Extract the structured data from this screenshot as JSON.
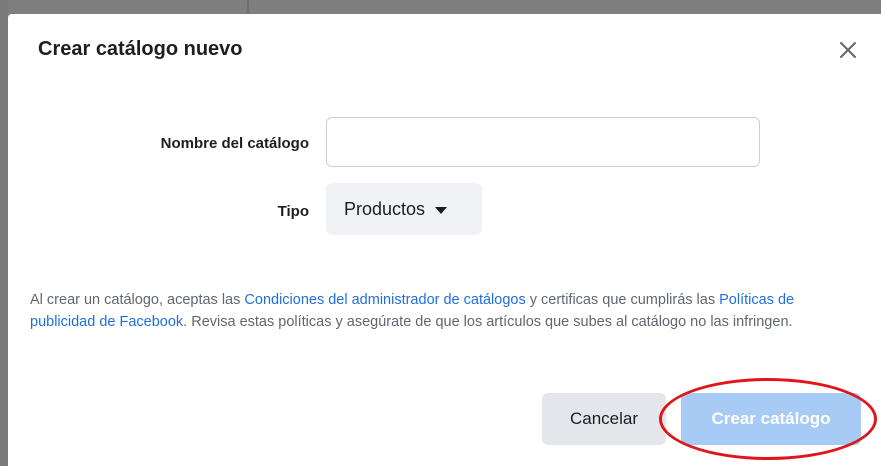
{
  "dialog": {
    "title": "Crear catálogo nuevo",
    "close_icon": "close-icon"
  },
  "form": {
    "name_label": "Nombre del catálogo",
    "name_value": "",
    "name_placeholder": "",
    "type_label": "Tipo",
    "type_selected": "Productos",
    "type_icon": "caret-down-icon"
  },
  "legal": {
    "part1": "Al crear un catálogo, aceptas las ",
    "link1": "Condiciones del administrador de catálogos",
    "part2": " y certificas que cumplirás las ",
    "link2": "Políticas de publicidad de Facebook",
    "part3": ". Revisa estas políticas y asegúrate de que los artículos que subes al catálogo no las infringen."
  },
  "actions": {
    "cancel_label": "Cancelar",
    "create_label": "Crear catálogo"
  },
  "colors": {
    "link": "#216fdb",
    "primary_disabled": "#a7cbf5",
    "annotation_ring": "#e0161b"
  }
}
